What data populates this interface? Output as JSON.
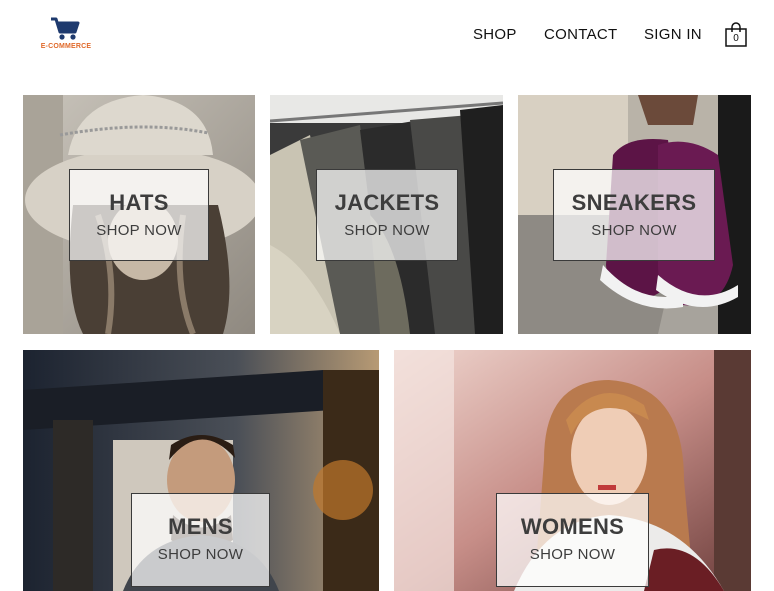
{
  "brand": {
    "name": "E-COMMERCE",
    "icon": "shopping-cart-icon",
    "color": "#e06a2b",
    "icon_color": "#1e3a6e"
  },
  "nav": {
    "shop": "SHOP",
    "contact": "CONTACT",
    "signin": "SIGN IN"
  },
  "cart": {
    "icon": "shopping-bag-icon",
    "count": "0"
  },
  "categories": [
    {
      "title": "HATS",
      "cta": "SHOP NOW"
    },
    {
      "title": "JACKETS",
      "cta": "SHOP NOW"
    },
    {
      "title": "SNEAKERS",
      "cta": "SHOP NOW"
    },
    {
      "title": "MENS",
      "cta": "SHOP NOW"
    },
    {
      "title": "WOMENS",
      "cta": "SHOP NOW"
    }
  ]
}
